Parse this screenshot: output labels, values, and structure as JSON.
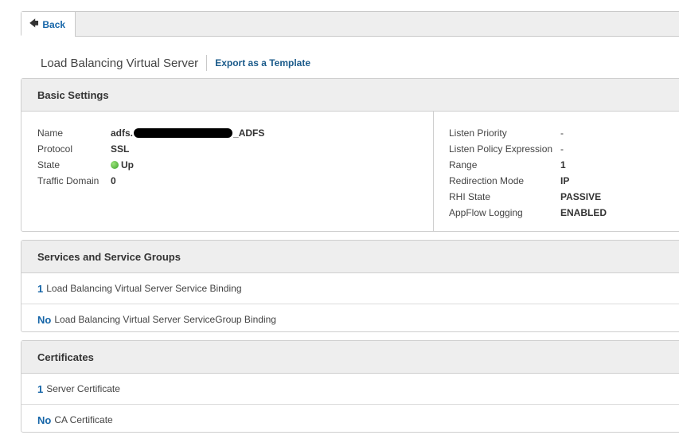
{
  "toolbar": {
    "back_label": "Back",
    "back_icon": "arrow-left-icon"
  },
  "header": {
    "title": "Load Balancing Virtual Server",
    "export_label": "Export as a Template"
  },
  "basic": {
    "heading": "Basic Settings",
    "left": [
      {
        "label": "Name",
        "value_prefix": "adfs.",
        "value_suffix": "_ADFS"
      },
      {
        "label": "Protocol",
        "value": "SSL"
      },
      {
        "label": "State",
        "value": "Up",
        "status_color": "#3aa12a"
      },
      {
        "label": "Traffic Domain",
        "value": "0"
      }
    ],
    "right": [
      {
        "label": "Listen Priority",
        "value": "-"
      },
      {
        "label": "Listen Policy Expression",
        "value": "-"
      },
      {
        "label": "Range",
        "value": "1"
      },
      {
        "label": "Redirection Mode",
        "value": "IP"
      },
      {
        "label": "RHI State",
        "value": "PASSIVE"
      },
      {
        "label": "AppFlow Logging",
        "value": "ENABLED"
      }
    ]
  },
  "services": {
    "heading": "Services and Service Groups",
    "rows": [
      {
        "count": "1",
        "label": "Load Balancing Virtual Server Service Binding"
      },
      {
        "count": "No",
        "label": "Load Balancing Virtual Server ServiceGroup Binding"
      }
    ]
  },
  "certificates": {
    "heading": "Certificates",
    "rows": [
      {
        "count": "1",
        "label": "Server Certificate"
      },
      {
        "count": "No",
        "label": "CA Certificate"
      }
    ]
  },
  "colors": {
    "link": "#1565a8",
    "header_bg": "#eeeeee",
    "border": "#cfcfcf"
  }
}
